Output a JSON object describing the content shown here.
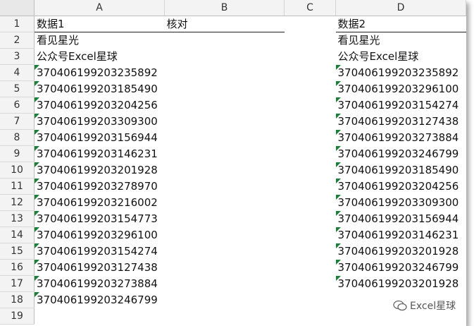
{
  "columns": [
    "A",
    "B",
    "C",
    "D"
  ],
  "rows": [
    "1",
    "2",
    "3",
    "4",
    "5",
    "6",
    "7",
    "8",
    "9",
    "10",
    "11",
    "12",
    "13",
    "14",
    "15",
    "16",
    "17",
    "18",
    "19"
  ],
  "headers": {
    "a1": "数据1",
    "b1": "核对",
    "d1": "数据2"
  },
  "col_a": [
    "看见星光",
    "公众号Excel星球",
    "370406199203235892",
    "370406199203185490",
    "370406199203204256",
    "370406199203309300",
    "370406199203156944",
    "370406199203146231",
    "370406199203201928",
    "370406199203278970",
    "370406199203216002",
    "370406199203154773",
    "370406199203296100",
    "370406199203154274",
    "370406199203127438",
    "370406199203273884",
    "370406199203246799"
  ],
  "col_d": [
    "看见星光",
    "公众号Excel星球",
    "370406199203235892",
    "370406199203296100",
    "370406199203154274",
    "370406199203127438",
    "370406199203273884",
    "370406199203246799",
    "370406199203185490",
    "370406199203204256",
    "370406199203309300",
    "370406199203156944",
    "370406199203146231",
    "370406199203201928",
    "370406199203246799",
    "370406199203201928"
  ],
  "watermark": "Excel星球",
  "colors": {
    "error_indicator": "#1a7f37"
  }
}
